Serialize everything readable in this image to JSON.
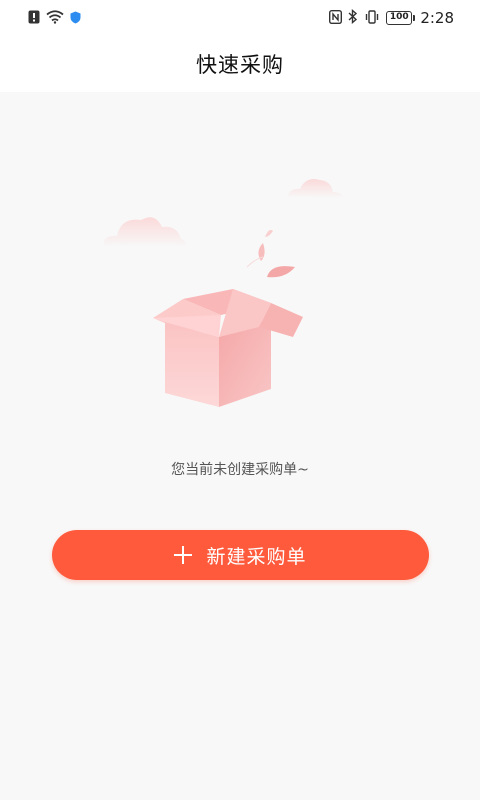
{
  "status_bar": {
    "time": "2:28",
    "battery": "100",
    "icons": [
      "alert-icon",
      "wifi-icon",
      "shield-icon",
      "nfc-icon",
      "bluetooth-icon",
      "vibrate-icon",
      "battery-icon"
    ]
  },
  "header": {
    "title": "快速采购"
  },
  "main": {
    "empty_message": "您当前未创建采购单~",
    "create_button_label": "新建采购单",
    "create_button_icon": "plus-icon"
  },
  "colors": {
    "accent": "#ff5a3c",
    "box": "#f7b4b4",
    "background": "#f8f8f8"
  }
}
